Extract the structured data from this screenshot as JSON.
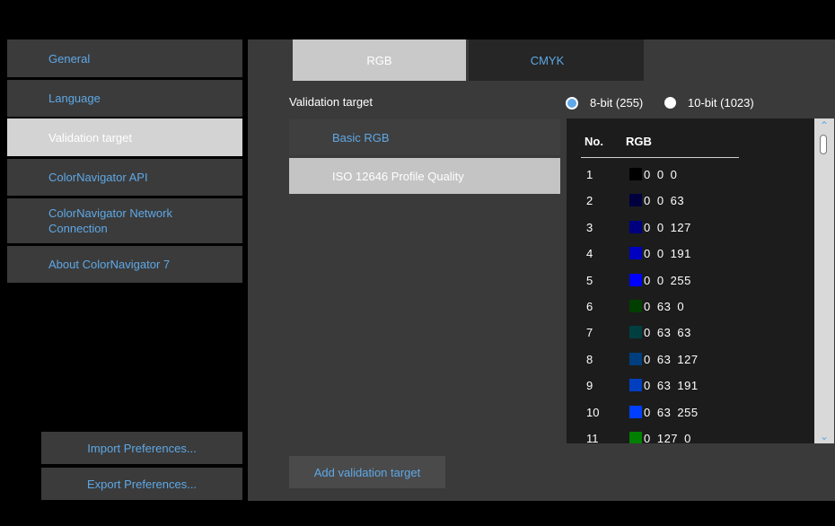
{
  "sidebar": {
    "items": [
      {
        "label": "General"
      },
      {
        "label": "Language"
      },
      {
        "label": "Validation target"
      },
      {
        "label": "ColorNavigator API"
      },
      {
        "label": "ColorNavigator Network Connection"
      },
      {
        "label": "About ColorNavigator 7"
      }
    ],
    "import_label": "Import Preferences...",
    "export_label": "Export Preferences..."
  },
  "tabs": [
    {
      "label": "RGB",
      "active": true
    },
    {
      "label": "CMYK",
      "active": false
    }
  ],
  "validation": {
    "title": "Validation target",
    "bit_options": [
      {
        "label": "8-bit (255)",
        "selected": true
      },
      {
        "label": "10-bit (1023)",
        "selected": false
      }
    ],
    "targets": [
      {
        "label": "Basic RGB"
      },
      {
        "label": "ISO 12646 Profile Quality"
      }
    ],
    "add_label": "Add validation target"
  },
  "color_table": {
    "header_no": "No.",
    "header_rgb": "RGB",
    "rows": [
      {
        "no": "1",
        "rgb": "0 0 0",
        "color": "#000000"
      },
      {
        "no": "2",
        "rgb": "0 0 63",
        "color": "#00003f"
      },
      {
        "no": "3",
        "rgb": "0 0 127",
        "color": "#00007f"
      },
      {
        "no": "4",
        "rgb": "0 0 191",
        "color": "#0000bf"
      },
      {
        "no": "5",
        "rgb": "0 0 255",
        "color": "#0000ff"
      },
      {
        "no": "6",
        "rgb": "0 63 0",
        "color": "#003f00"
      },
      {
        "no": "7",
        "rgb": "0 63 63",
        "color": "#003f3f"
      },
      {
        "no": "8",
        "rgb": "0 63 127",
        "color": "#003f7f"
      },
      {
        "no": "9",
        "rgb": "0 63 191",
        "color": "#003fbf"
      },
      {
        "no": "10",
        "rgb": "0 63 255",
        "color": "#003fff"
      },
      {
        "no": "11",
        "rgb": "0 127 0",
        "color": "#007f00"
      }
    ]
  },
  "colors": {
    "accent": "#5ea8e6",
    "panel": "#3a3a3a",
    "active_item": "#d3d3d3"
  }
}
